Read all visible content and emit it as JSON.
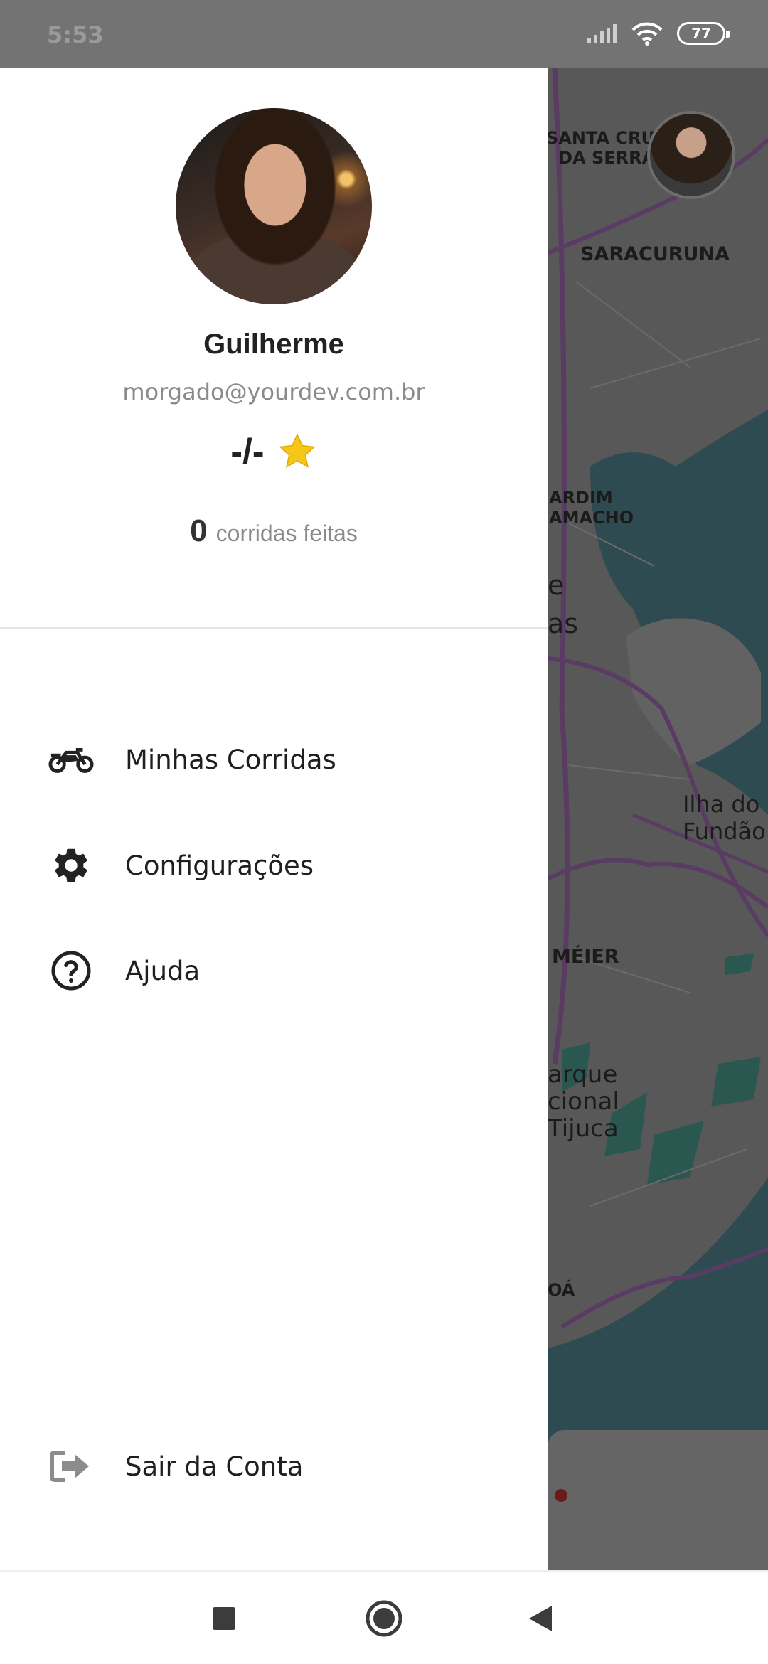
{
  "status_bar": {
    "time": "5:53",
    "battery": "77"
  },
  "map": {
    "labels": [
      "SANTA CRUZ\nDA SERRA",
      "SARACURUNA",
      "ARDIM\nAMACHO",
      "e\nas",
      "Ilha do\nFundão",
      "MÉIER",
      "arque\ncional\nTijuca",
      "OÁ"
    ]
  },
  "profile": {
    "name": "Guilherme",
    "email": "morgado@yourdev.com.br",
    "rating": "-/-",
    "rides_count": "0",
    "rides_label": "corridas feitas"
  },
  "menu": {
    "items": [
      {
        "label": "Minhas Corridas",
        "icon": "motorcycle-icon"
      },
      {
        "label": "Configurações",
        "icon": "gear-icon"
      },
      {
        "label": "Ajuda",
        "icon": "help-circle-icon"
      }
    ],
    "logout": {
      "label": "Sair da Conta",
      "icon": "logout-icon"
    }
  },
  "colors": {
    "status_bar": "#737373",
    "star": "#f5c518",
    "map_overlay": "#585858",
    "text": "#1f1f1f",
    "muted": "#8a8a8a"
  }
}
